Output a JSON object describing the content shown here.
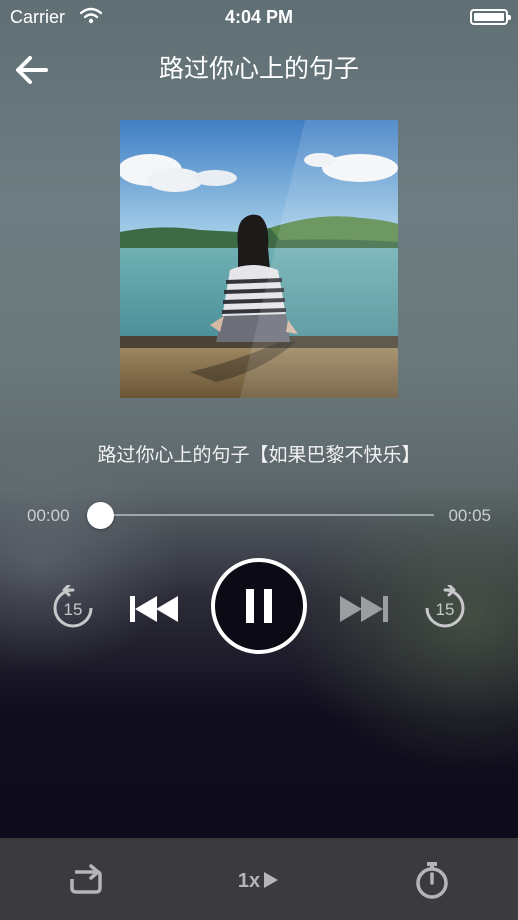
{
  "status_bar": {
    "carrier": "Carrier",
    "time": "4:04 PM"
  },
  "header": {
    "title": "路过你心上的句子"
  },
  "track": {
    "full_title": "路过你心上的句子【如果巴黎不快乐】"
  },
  "progress": {
    "elapsed": "00:00",
    "duration": "00:05",
    "fraction": 0.0
  },
  "controls": {
    "rewind_seconds": "15",
    "forward_seconds": "15",
    "state": "playing"
  },
  "bottom_bar": {
    "speed_label": "1x"
  },
  "icons": {
    "back": "arrow-left-icon",
    "rewind": "rewind-15-icon",
    "previous": "skip-previous-icon",
    "pause": "pause-icon",
    "next": "skip-next-icon",
    "forward": "forward-15-icon",
    "repeat": "repeat-icon",
    "timer": "stopwatch-icon"
  },
  "colors": {
    "bottom_bar": "#3b3b3e",
    "icon_gray": "#b5b5b8",
    "accent": "#ffffff"
  }
}
